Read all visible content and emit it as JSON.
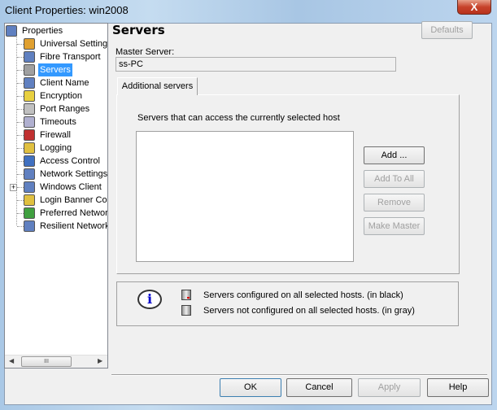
{
  "window": {
    "title": "Client Properties: win2008",
    "close_label": "X"
  },
  "tree": {
    "root": "Properties",
    "items": [
      {
        "label": "Universal Settings",
        "icon": "universal-settings-icon",
        "color": "#e0a030"
      },
      {
        "label": "Fibre Transport",
        "icon": "computer-icon",
        "color": "#6080c0"
      },
      {
        "label": "Servers",
        "icon": "server-icon",
        "color": "#a0a0a0",
        "selected": true
      },
      {
        "label": "Client Name",
        "icon": "computer-icon",
        "color": "#6080c0"
      },
      {
        "label": "Encryption",
        "icon": "lock-icon",
        "color": "#e8d040"
      },
      {
        "label": "Port Ranges",
        "icon": "port-icon",
        "color": "#c0c0c0"
      },
      {
        "label": "Timeouts",
        "icon": "clock-icon",
        "color": "#b0b0d0"
      },
      {
        "label": "Firewall",
        "icon": "firewall-icon",
        "color": "#c03030"
      },
      {
        "label": "Logging",
        "icon": "log-icon",
        "color": "#e0c040"
      },
      {
        "label": "Access Control",
        "icon": "access-control-icon",
        "color": "#4070c0"
      },
      {
        "label": "Network Settings",
        "icon": "network-icon",
        "color": "#6080c0"
      },
      {
        "label": "Windows Client",
        "icon": "computer-icon",
        "color": "#6080c0",
        "expandable": true
      },
      {
        "label": "Login Banner Conf",
        "icon": "banner-icon",
        "color": "#e0c040"
      },
      {
        "label": "Preferred Network",
        "icon": "preferred-network-icon",
        "color": "#40a040"
      },
      {
        "label": "Resilient Network",
        "icon": "resilient-network-icon",
        "color": "#6080c0"
      }
    ],
    "scroll_thumb": "III"
  },
  "page": {
    "title": "Servers",
    "defaults_label": "Defaults",
    "master_label": "Master Server:",
    "master_value": "ss-PC",
    "tab_label": "Additional servers",
    "list_label": "Servers that can access the currently selected host",
    "buttons": {
      "add": "Add ...",
      "add_all": "Add To All",
      "remove": "Remove",
      "make_master": "Make Master"
    },
    "legend": {
      "black": "Servers configured on all selected hosts. (in black)",
      "gray": "Servers not configured on all selected hosts. (in gray)",
      "info_glyph": "i"
    }
  },
  "footer": {
    "ok": "OK",
    "cancel": "Cancel",
    "apply": "Apply",
    "help": "Help"
  }
}
